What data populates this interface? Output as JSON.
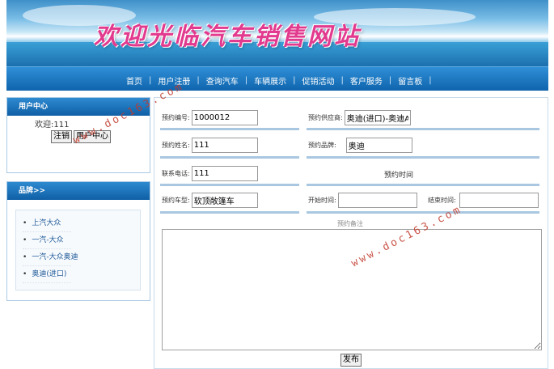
{
  "banner": {
    "title": "欢迎光临汽车销售网站"
  },
  "nav": {
    "items": [
      "首页",
      "用户注册",
      "查询汽车",
      "车辆展示",
      "促销活动",
      "客户服务",
      "留言板"
    ]
  },
  "user_center": {
    "header": "用户中心",
    "welcome": "欢迎:111",
    "logout": "注销",
    "center": "用户中心"
  },
  "brands": {
    "header": "品牌>>",
    "items": [
      "上汽大众",
      "一汽-大众",
      "一汽-大众奥迪",
      "奥迪(进口)"
    ]
  },
  "form": {
    "order_no_label": "预约编号:",
    "order_no": "1000012",
    "supplier_label": "预约供应商:",
    "supplier": "奥迪(进口)-奥迪A",
    "name_label": "预约姓名:",
    "name": "111",
    "brand_label": "预约品牌:",
    "brand": "奥迪",
    "phone_label": "联系电话:",
    "phone": "111",
    "time_caption": "预约时间",
    "model_label": "预约车型:",
    "model": "软顶敞篷车",
    "start_label": "开始时间:",
    "start": "",
    "end_label": "结束时间:",
    "end": "",
    "note_label": "预约备注",
    "submit": "发布"
  },
  "watermark": "www.doc163.com"
}
